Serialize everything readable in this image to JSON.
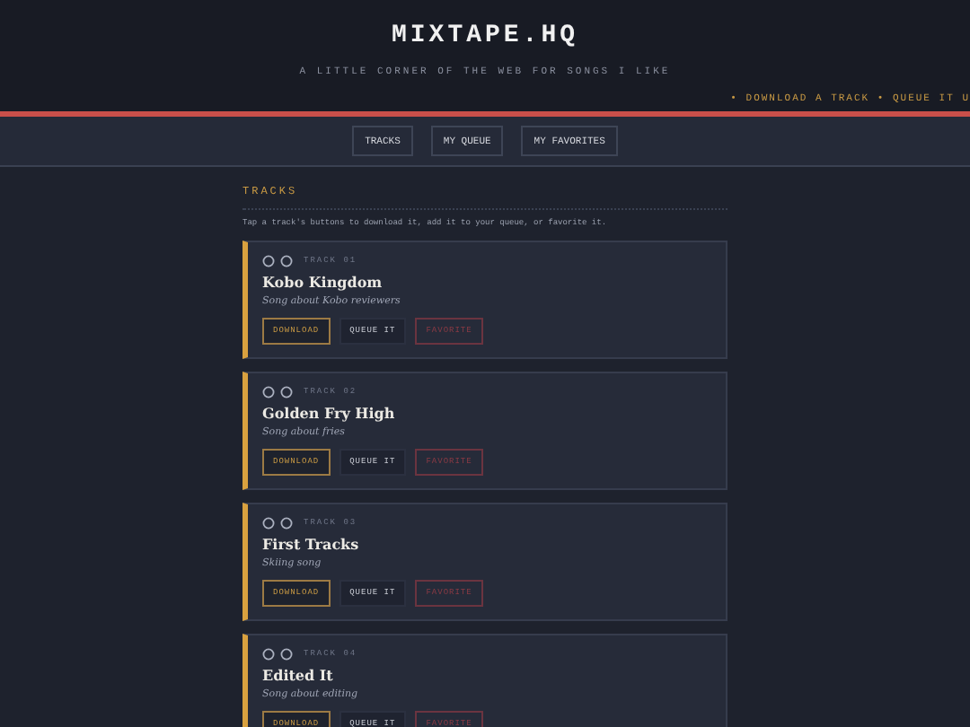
{
  "header": {
    "title": "MIXTAPE.HQ",
    "tagline": "A LITTLE CORNER OF THE WEB FOR SONGS I LIKE",
    "ticker": "• DOWNLOAD A TRACK • QUEUE IT U"
  },
  "nav": [
    {
      "label": "TRACKS"
    },
    {
      "label": "MY QUEUE"
    },
    {
      "label": "MY FAVORITES"
    }
  ],
  "section": {
    "heading": "TRACKS",
    "intro": "Tap a track's buttons to download it, add it to your queue, or favorite it."
  },
  "tracks": [
    {
      "number": "TRACK 01",
      "title": "Kobo Kingdom",
      "subtitle": "Song about Kobo reviewers",
      "buttons": [
        {
          "kind": "download",
          "label": "DOWNLOAD"
        },
        {
          "kind": "queue",
          "label": "QUEUE IT"
        },
        {
          "kind": "favorite",
          "label": "FAVORITE"
        }
      ]
    },
    {
      "number": "TRACK 02",
      "title": "Golden Fry High",
      "subtitle": "Song about fries",
      "buttons": [
        {
          "kind": "download",
          "label": "DOWNLOAD"
        },
        {
          "kind": "queue",
          "label": "QUEUE IT"
        },
        {
          "kind": "favorite",
          "label": "FAVORITE"
        }
      ]
    },
    {
      "number": "TRACK 03",
      "title": "First Tracks",
      "subtitle": "Skiing song",
      "buttons": [
        {
          "kind": "download",
          "label": "DOWNLOAD"
        },
        {
          "kind": "queue",
          "label": "QUEUE IT"
        },
        {
          "kind": "favorite",
          "label": "FAVORITE"
        }
      ]
    },
    {
      "number": "TRACK 04",
      "title": "Edited It",
      "subtitle": "Song about editing",
      "buttons": [
        {
          "kind": "download",
          "label": "DOWNLOAD"
        },
        {
          "kind": "queue",
          "label": "QUEUE IT"
        },
        {
          "kind": "favorite",
          "label": "FAVORITE"
        }
      ]
    }
  ]
}
